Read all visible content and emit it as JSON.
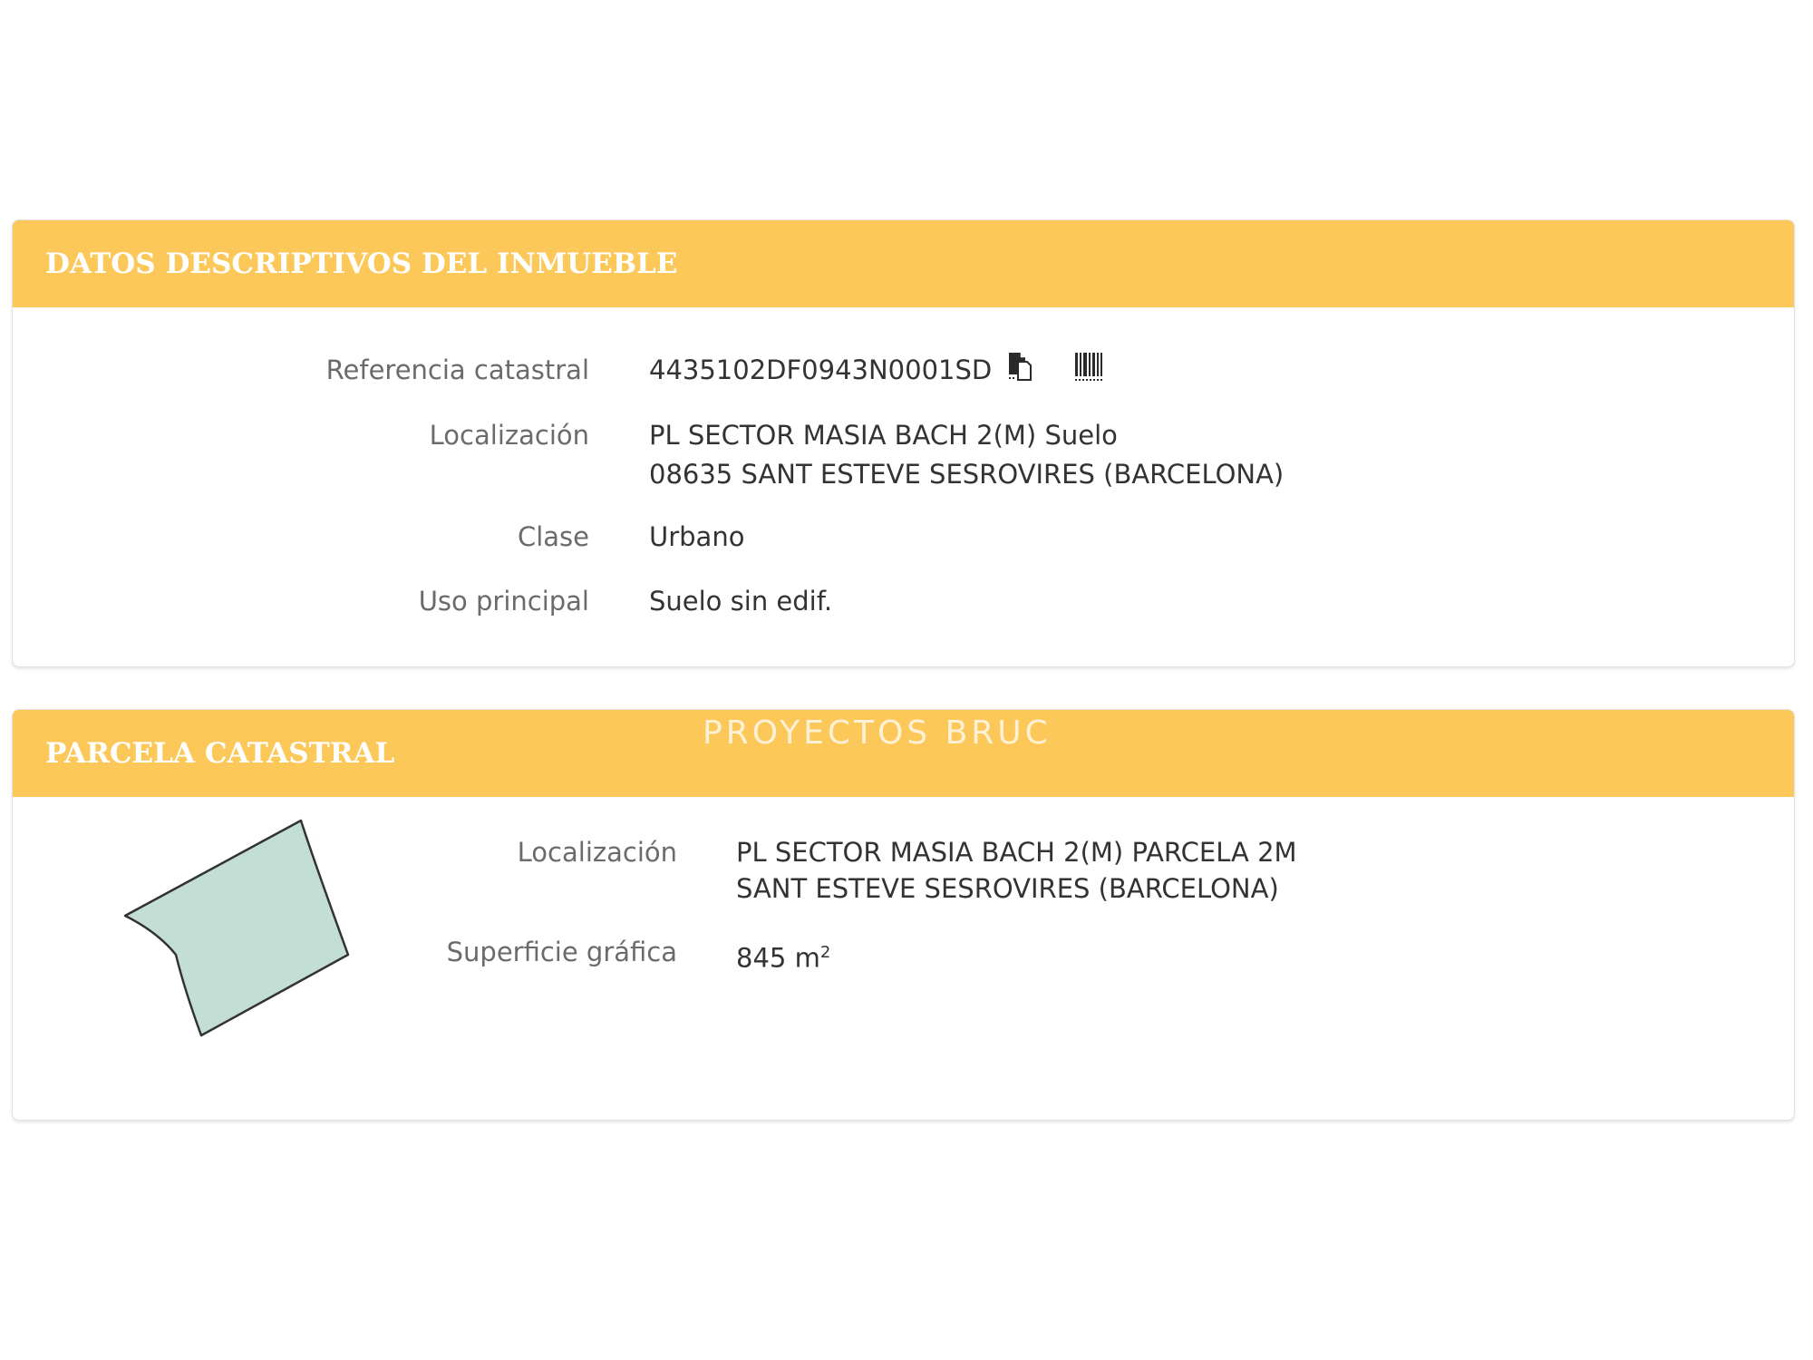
{
  "datos_panel": {
    "title": "DATOS DESCRIPTIVOS DEL INMUEBLE",
    "referencia": {
      "label": "Referencia catastral",
      "value": "4435102DF0943N0001SD",
      "copy_icon": "copy-icon",
      "barcode_icon": "barcode-icon"
    },
    "localizacion": {
      "label": "Localización",
      "line1": "PL SECTOR MASIA BACH 2(M) Suelo",
      "line2": "08635 SANT ESTEVE SESROVIRES (BARCELONA)"
    },
    "clase": {
      "label": "Clase",
      "value": "Urbano"
    },
    "uso": {
      "label": "Uso principal",
      "value": "Suelo sin edif."
    }
  },
  "parcela_panel": {
    "title": "PARCELA CATASTRAL",
    "localizacion": {
      "label": "Localización",
      "line1": "PL SECTOR MASIA BACH 2(M) PARCELA 2M",
      "line2": "SANT ESTEVE SESROVIRES (BARCELONA)"
    },
    "superficie": {
      "label": "Superficie gráfica",
      "value": "845 m",
      "unit_exp": "2"
    }
  },
  "watermark": "PROYECTOS BRUC",
  "colors": {
    "header": "#fcc85a",
    "parcel_fill": "#c3dfd5",
    "label_text": "#6b6b6b",
    "value_text": "#333333"
  }
}
